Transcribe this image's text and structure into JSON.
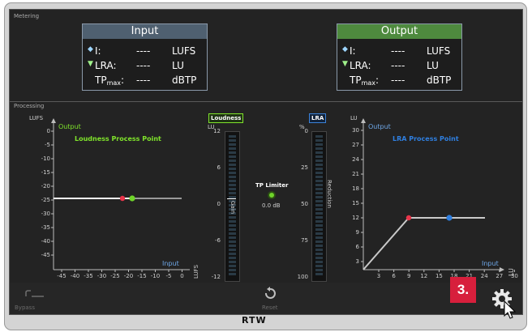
{
  "metering": {
    "section_label": "Metering",
    "input": {
      "title": "Input",
      "rows": [
        {
          "label": "I:",
          "value": "----",
          "unit": "LUFS"
        },
        {
          "label": "LRA:",
          "value": "----",
          "unit": "LU"
        },
        {
          "label": "TP",
          "label_sub": "max",
          "label_suffix": ":",
          "value": "----",
          "unit": "dBTP"
        }
      ]
    },
    "output": {
      "title": "Output",
      "rows": [
        {
          "label": "I:",
          "value": "----",
          "unit": "LUFS"
        },
        {
          "label": "LRA:",
          "value": "----",
          "unit": "LU"
        },
        {
          "label": "TP",
          "label_sub": "max",
          "label_suffix": ":",
          "value": "----",
          "unit": "dBTP"
        }
      ]
    }
  },
  "processing": {
    "section_label": "Processing",
    "loudness_graph": {
      "y_unit": "LUFS",
      "y_axis_label": "Output",
      "title": "Loudness Process Point",
      "x_axis_label": "Input",
      "x_unit": "LUFS",
      "y_ticks": [
        "0",
        "-5",
        "-10",
        "-15",
        "-20",
        "-25",
        "-30",
        "-35",
        "-40",
        "-45"
      ],
      "x_ticks": [
        "-45",
        "-40",
        "-35",
        "-30",
        "-25",
        "-20",
        "-15",
        "-10",
        "-5",
        "0"
      ]
    },
    "loudness_meter": {
      "tag": "Loudness",
      "unit": "LU",
      "ticks": [
        "12",
        "6",
        "0",
        "-6",
        "-12"
      ],
      "side_label": "Gain"
    },
    "tp_limiter": {
      "label": "TP Limiter",
      "value": "0.0 dB"
    },
    "lra_meter": {
      "tag": "LRA",
      "unit": "%",
      "ticks": [
        "0",
        "25",
        "50",
        "75",
        "100"
      ],
      "side_label": "Reduction"
    },
    "lra_graph": {
      "y_unit": "LU",
      "y_axis_label": "Output",
      "title": "LRA Process Point",
      "x_axis_label": "Input",
      "x_unit": "LU",
      "y_ticks": [
        "30",
        "27",
        "24",
        "21",
        "18",
        "15",
        "12",
        "9",
        "6",
        "3"
      ],
      "x_ticks": [
        "3",
        "6",
        "9",
        "12",
        "15",
        "18",
        "21",
        "24",
        "27",
        "30"
      ]
    }
  },
  "bottom_bar": {
    "bypass_label": "Bypass",
    "reset_label": "Reset",
    "step_badge": "3."
  },
  "brand": "RTW",
  "colors": {
    "loudness_title": "#7fe32b",
    "lra_title": "#2f7fe0",
    "input_header": "#4f6070",
    "output_header": "#4e8a3e",
    "marker_red": "#e8354a",
    "marker_green": "#6fd42a",
    "marker_blue": "#2f7fe0",
    "badge": "#d71f3c"
  }
}
